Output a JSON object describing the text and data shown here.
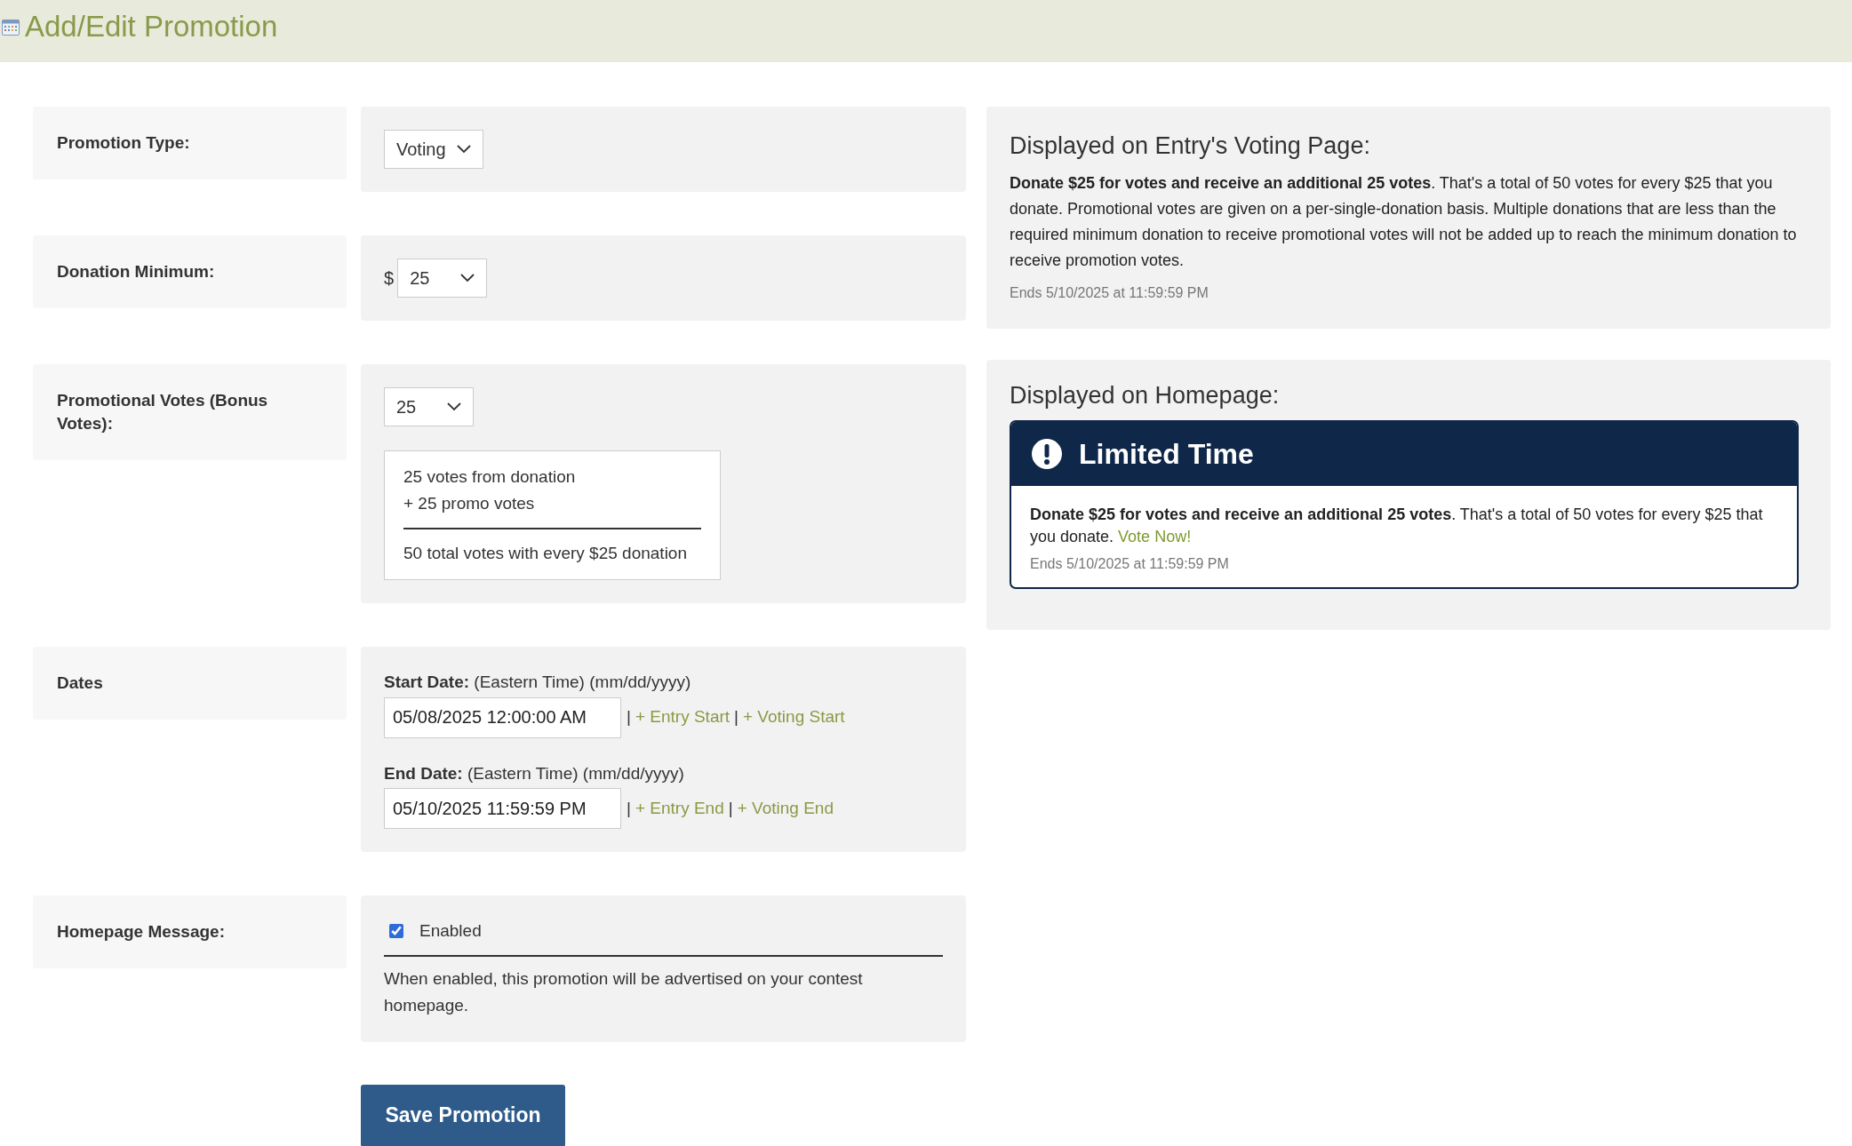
{
  "header": {
    "title": "Add/Edit Promotion"
  },
  "form": {
    "rows": [
      {
        "kind": "select",
        "label": "Promotion Type:",
        "value": "Voting"
      },
      {
        "kind": "currency",
        "label": "Donation Minimum:",
        "prefix": "$",
        "value": "25"
      },
      {
        "kind": "votes",
        "label": "Promotional Votes (Bonus Votes):",
        "value": "25",
        "summary": {
          "lines": [
            "25 votes from donation",
            "+ 25 promo votes"
          ],
          "total": "50 total votes with every $25 donation"
        }
      },
      {
        "kind": "dates",
        "label": "Dates",
        "dates": [
          {
            "label": "Start Date:",
            "note": "(Eastern Time) (mm/dd/yyyy)",
            "value": "05/08/2025 12:00:00 AM",
            "items": [
              {
                "kind": "separator",
                "text": "|"
              },
              {
                "kind": "link",
                "text": "+ Entry Start"
              },
              {
                "kind": "separator",
                "text": "|"
              },
              {
                "kind": "link",
                "text": "+ Voting Start"
              }
            ]
          },
          {
            "label": "End Date:",
            "note": "(Eastern Time) (mm/dd/yyyy)",
            "value": "05/10/2025 11:59:59 PM",
            "items": [
              {
                "kind": "separator",
                "text": "|"
              },
              {
                "kind": "link",
                "text": "+ Entry End"
              },
              {
                "kind": "separator",
                "text": "|"
              },
              {
                "kind": "link",
                "text": "+ Voting End"
              }
            ]
          }
        ]
      },
      {
        "kind": "checkbox",
        "label": "Homepage Message:",
        "checkbox_label": "Enabled",
        "checked": true,
        "help": "When enabled, this promotion will be advertised on your contest homepage."
      }
    ],
    "save_button": "Save Promotion"
  },
  "previews": {
    "voting_page": {
      "title": "Displayed on Entry's Voting Page:",
      "text": "**Donate $25 for votes and receive an additional 25 votes**. That's a total of 50 votes for every $25 that you donate. Promotional votes are given on a per-single-donation basis. Multiple donations that are less than the required minimum donation to receive promotional votes will not be added up to reach the minimum donation to receive promotion votes.",
      "ends": "Ends 5/10/2025 at 11:59:59 PM"
    },
    "homepage": {
      "title": "Displayed on Homepage:",
      "banner_title": "Limited Time",
      "text": "**Donate $25 for votes and receive an additional 25 votes**. That's a total of 50 votes for every $25 that you donate. ",
      "link": "Vote Now!",
      "ends": "Ends 5/10/2025 at 11:59:59 PM"
    }
  }
}
